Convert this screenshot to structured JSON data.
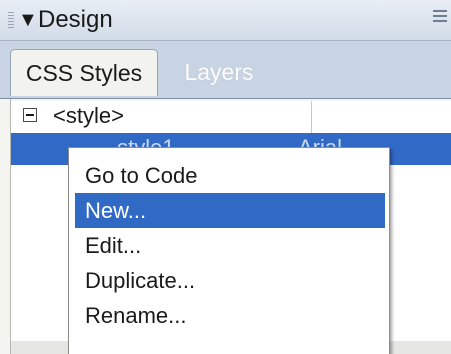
{
  "panel": {
    "title": "Design",
    "collapse_icon": "triangle-down-icon",
    "options_icon": "panel-options-icon"
  },
  "tabs": [
    {
      "label": "CSS Styles",
      "active": true
    },
    {
      "label": "Layers",
      "active": false
    }
  ],
  "styles_list": {
    "rows": [
      {
        "label": "<style>",
        "expanded": true
      },
      {
        "label": ".style1",
        "value": "Arial",
        "selected": true
      }
    ]
  },
  "context_menu": {
    "items": [
      {
        "label": "Go to Code"
      },
      {
        "label": "New...",
        "highlighted": true
      },
      {
        "label": "Edit..."
      },
      {
        "label": "Duplicate..."
      },
      {
        "label": "Rename..."
      },
      {
        "label": ""
      }
    ]
  },
  "colors": {
    "selection": "#316ac5",
    "panel_bg": "#c8d3e3"
  }
}
